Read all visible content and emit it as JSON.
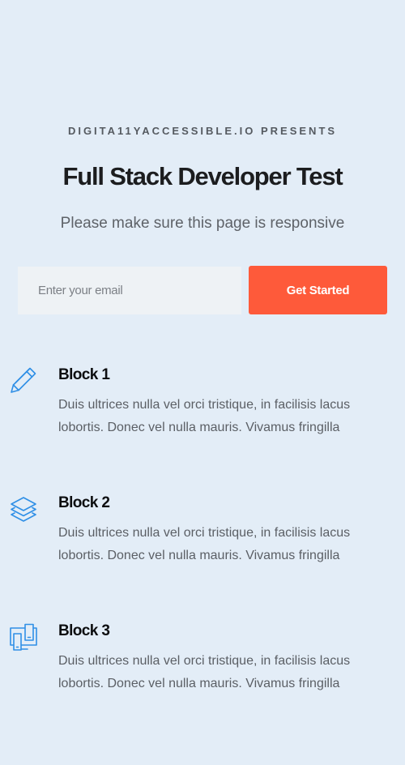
{
  "hero": {
    "eyebrow": "DIGITA11YACCESSIBLE.IO PRESENTS",
    "title": "Full Stack Developer Test",
    "subtitle": "Please make sure this page is responsive"
  },
  "signup": {
    "email_placeholder": "Enter your email",
    "email_value": "",
    "button_label": "Get Started"
  },
  "blocks": [
    {
      "icon": "pencil-icon",
      "title": "Block 1",
      "text": "Duis ultrices nulla vel orci tristique, in facilisis lacus lobortis. Donec vel nulla mauris. Vivamus fringilla"
    },
    {
      "icon": "layers-icon",
      "title": "Block 2",
      "text": "Duis ultrices nulla vel orci tristique, in facilisis lacus lobortis. Donec vel nulla mauris. Vivamus fringilla"
    },
    {
      "icon": "devices-icon",
      "title": "Block 3",
      "text": "Duis ultrices nulla vel orci tristique, in facilisis lacus lobortis. Donec vel nulla mauris. Vivamus fringilla"
    }
  ],
  "colors": {
    "background": "#e3edf7",
    "accent": "#fe5a3a",
    "icon": "#2f8fe6"
  }
}
